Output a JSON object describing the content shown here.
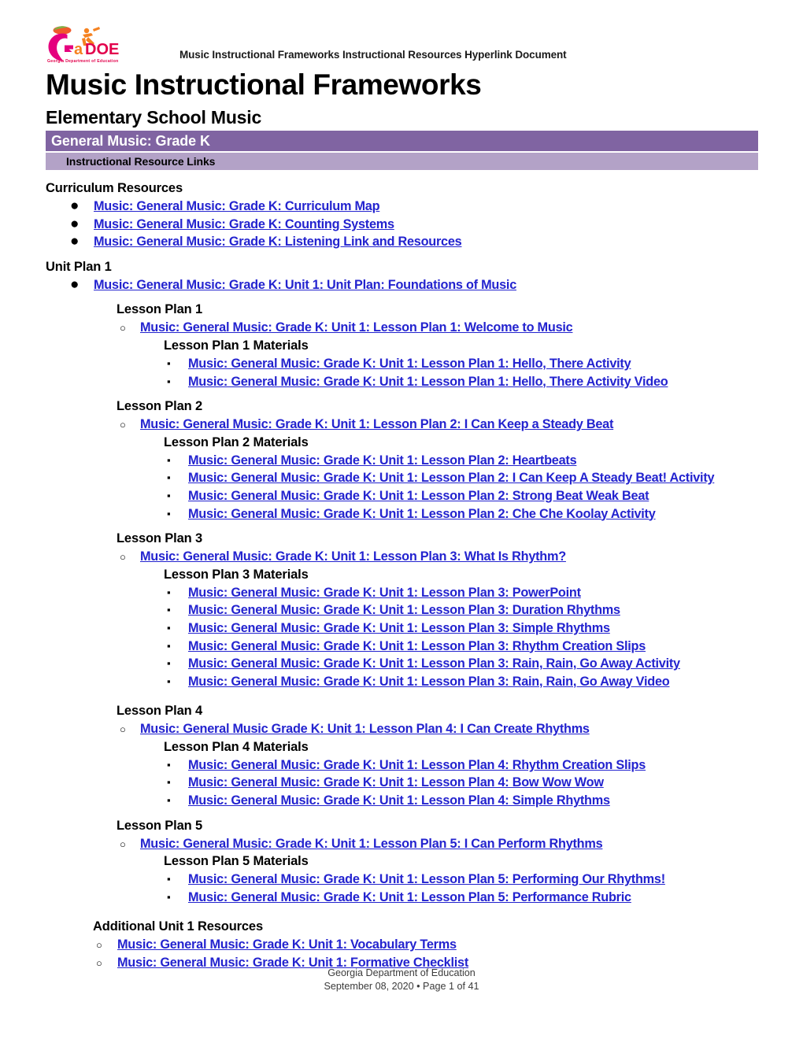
{
  "document": {
    "running_header": "Music Instructional Frameworks Instructional Resources Hyperlink Document",
    "title": "Music Instructional Frameworks",
    "subtitle": "Elementary School Music",
    "band_primary": "General Music: Grade K",
    "band_secondary": "Instructional Resource Links"
  },
  "logo": {
    "wordmark": "GaDOE",
    "tagline": "Georgia Department of Education",
    "colors": {
      "peach": "#f0592b",
      "leaf": "#7ab648",
      "magenta": "#e5007e",
      "orange": "#f58220",
      "crimson": "#e2004b"
    }
  },
  "colors": {
    "link": "#2323cf",
    "band_dark": "#8064a2",
    "band_light": "#b3a2c7"
  },
  "sections": {
    "curriculum_resources": {
      "heading": "Curriculum Resources",
      "links": [
        "Music: General Music: Grade K: Curriculum Map",
        "Music: General Music: Grade K: Counting Systems",
        "Music: General Music: Grade K: Listening Link and Resources"
      ]
    },
    "unit_plan_1": {
      "heading": "Unit Plan 1",
      "unit_plan_link": "Music: General Music: Grade K: Unit 1: Unit Plan: Foundations of Music ",
      "lesson_plans": [
        {
          "heading": "Lesson Plan 1",
          "link": "Music: General Music: Grade K: Unit 1: Lesson Plan 1: Welcome to Music",
          "materials_heading": "Lesson Plan 1 Materials",
          "materials": [
            "Music: General Music: Grade K: Unit 1: Lesson Plan 1: Hello, There Activity",
            "Music: General Music: Grade K: Unit 1: Lesson Plan 1: Hello, There Activity Video "
          ]
        },
        {
          "heading": "Lesson Plan 2",
          "link": "Music: General Music: Grade K: Unit 1: Lesson Plan 2: I Can Keep a Steady Beat",
          "materials_heading": "Lesson Plan 2 Materials",
          "materials": [
            "Music: General Music: Grade K: Unit 1: Lesson Plan 2: Heartbeats",
            "Music: General Music: Grade K: Unit 1: Lesson Plan 2: I Can Keep A Steady Beat! Activity",
            "Music: General Music: Grade K: Unit 1: Lesson Plan 2: Strong Beat Weak Beat",
            "Music: General Music: Grade K: Unit 1: Lesson Plan 2: Che Che Koolay Activity"
          ]
        },
        {
          "heading": "Lesson Plan 3",
          "link": "Music: General Music: Grade K: Unit 1: Lesson Plan 3: What Is Rhythm?",
          "materials_heading": "Lesson Plan 3 Materials",
          "materials": [
            "Music: General Music: Grade K: Unit 1: Lesson Plan 3: PowerPoint",
            "Music: General Music: Grade K: Unit 1: Lesson Plan 3: Duration Rhythms",
            "Music: General Music: Grade K: Unit 1: Lesson Plan 3: Simple Rhythms ",
            "Music: General Music: Grade K: Unit 1: Lesson Plan 3: Rhythm Creation Slips ",
            "Music: General Music: Grade K: Unit 1: Lesson Plan 3: Rain, Rain, Go Away Activity",
            "Music: General Music: Grade K: Unit 1: Lesson Plan 3: Rain, Rain, Go Away Video"
          ]
        },
        {
          "heading": "Lesson Plan 4",
          "link": "Music: General Music Grade K: Unit 1: Lesson Plan 4: I Can Create Rhythms",
          "materials_heading": "Lesson Plan 4 Materials",
          "materials": [
            "Music: General Music: Grade K: Unit 1: Lesson Plan 4: Rhythm Creation Slips",
            "Music: General Music: Grade K: Unit 1: Lesson Plan 4: Bow Wow Wow",
            "Music: General Music: Grade K: Unit 1: Lesson Plan 4: Simple Rhythms"
          ]
        },
        {
          "heading": "Lesson Plan 5",
          "link": "Music: General Music: Grade K: Unit 1: Lesson Plan 5: I Can Perform Rhythms",
          "materials_heading": "Lesson Plan 5 Materials",
          "materials": [
            "Music: General Music: Grade K: Unit 1: Lesson Plan 5: Performing Our Rhythms!",
            "Music: General Music: Grade K: Unit 1: Lesson Plan 5: Performance Rubric"
          ]
        }
      ],
      "additional": {
        "heading": "Additional Unit 1 Resources",
        "links": [
          "Music: General Music: Grade K: Unit 1: Vocabulary Terms",
          "Music: General Music: Grade K: Unit 1: Formative Checklist"
        ]
      }
    }
  },
  "footer": {
    "line1": "Georgia Department of Education",
    "line2": "September 08, 2020 • Page 1 of 41"
  },
  "markers": {
    "disc": "●",
    "circle": "○",
    "square": "▪"
  }
}
